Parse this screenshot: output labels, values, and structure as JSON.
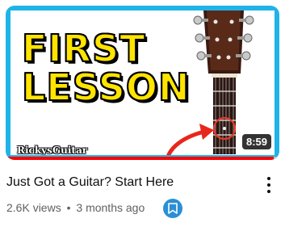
{
  "video": {
    "thumbnail": {
      "headline_line1": "FIRST",
      "headline_line2": "LESSON",
      "channel_watermark": "RickysGuitar",
      "duration": "8:59",
      "watch_progress": 0.98,
      "frame_color": "#1fb3e8"
    },
    "title": "Just Got a Guitar? Start Here",
    "views": "2.6K views",
    "separator": "•",
    "age": "3 months ago",
    "icons": {
      "save": "bookmark-icon",
      "menu": "more-vert-icon"
    }
  }
}
